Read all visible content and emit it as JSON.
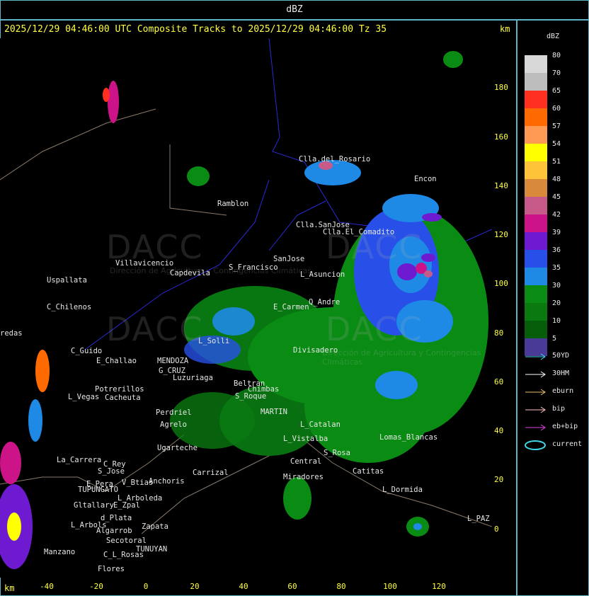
{
  "title": "dBZ",
  "subtitle": "2025/12/29 04:46:00 UTC Composite Tracks to 2025/12/29 04:46:00 Tz 35",
  "km_top": "km",
  "km_bottom": "km",
  "legend": {
    "title": "dBZ",
    "levels": [
      {
        "value": "80",
        "color": "#d8d8d8"
      },
      {
        "value": "70",
        "color": "#bdbdbd"
      },
      {
        "value": "65",
        "color": "#ff3020"
      },
      {
        "value": "60",
        "color": "#ff6a00"
      },
      {
        "value": "57",
        "color": "#ff9a55"
      },
      {
        "value": "54",
        "color": "#ffff00"
      },
      {
        "value": "51",
        "color": "#ffc33a"
      },
      {
        "value": "48",
        "color": "#d88a3a"
      },
      {
        "value": "45",
        "color": "#c85a8a"
      },
      {
        "value": "42",
        "color": "#cc1488"
      },
      {
        "value": "39",
        "color": "#6e1ad0"
      },
      {
        "value": "36",
        "color": "#2850e8"
      },
      {
        "value": "35",
        "color": "#1e8ae6"
      },
      {
        "value": "30",
        "color": "#0a8c14"
      },
      {
        "value": "20",
        "color": "#0a7a10"
      },
      {
        "value": "10",
        "color": "#065e0a"
      },
      {
        "value": "5",
        "color": "#4a3a98"
      }
    ],
    "tracks": [
      {
        "label": "50YD",
        "color": "#40d8e8"
      },
      {
        "label": "30HM",
        "color": "#ffffff"
      },
      {
        "label": "eburn",
        "color": "#e8c070"
      },
      {
        "label": "bip",
        "color": "#ffc0c0"
      },
      {
        "label": "eb+bip",
        "color": "#e040e0"
      },
      {
        "label": "current",
        "color": "#40d8e8"
      }
    ]
  },
  "y_axis_ticks": [
    "180",
    "160",
    "140",
    "120",
    "100",
    "80",
    "60",
    "40",
    "20",
    "0"
  ],
  "x_axis_ticks": [
    "-40",
    "-20",
    "0",
    "20",
    "40",
    "60",
    "80",
    "100",
    "120"
  ],
  "watermark": {
    "text": "DACC",
    "sub": "Dirección de Agricultura y Contingencias Climáticas"
  },
  "places": [
    "Clla.del_Rosario",
    "Encon",
    "Ramblon",
    "Clla.SanJose",
    "Clla.El_Comadito",
    "Villavicencio",
    "S_Francisco",
    "SanJose",
    "L_Asuncion",
    "Uspallata",
    "Capdevila",
    "C_Chilenos",
    "E_Carmen",
    "Q_Andre",
    "redas",
    "L_Solli",
    "Divisadero",
    "C_Guido",
    "E_Challao",
    "MENDOZA",
    "G_CRUZ",
    "Luzuriaga",
    "Potrerillos",
    "L_Vegas",
    "Cacheuta",
    "Perdriel",
    "Agrelo",
    "Beltran",
    "Chimbas",
    "S_Roque",
    "MARTIN",
    "L_Catalan",
    "L_Vistalba",
    "Ugarteche",
    "Lomas_Blancas",
    "S_Rosa",
    "La_Carrera",
    "C_Rey",
    "S_Jose",
    "E_Pera",
    "V_Btias",
    "Anchoris",
    "TUPUNGATO",
    "L_Arboleda",
    "Carrizal",
    "Catitas",
    "Miradores",
    "Central",
    "Gltallary",
    "E_Zpal",
    "d_Plata",
    "L_Arbols",
    "Zapata",
    "L_Dormida",
    "L_PAZ",
    "Algarrob",
    "Secotoral",
    "TUNUYAN",
    "Manzano",
    "C_L_Rosas",
    "Flores"
  ]
}
